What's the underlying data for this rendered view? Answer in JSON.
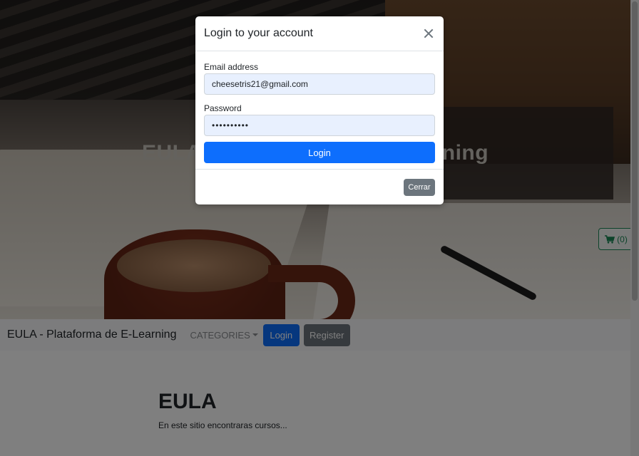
{
  "hero": {
    "title": "EULA - Plataforma de E-Learning"
  },
  "cart": {
    "label": "(0)",
    "icon": "shopping-cart-icon",
    "color": "#198754"
  },
  "navbar": {
    "brand": "EULA - Plataforma de E-Learning",
    "categories": "CATEGORIES",
    "login": "Login",
    "register": "Register"
  },
  "main": {
    "heading": "EULA",
    "description": "En este sitio encontraras cursos..."
  },
  "modal": {
    "title": "Login to your account",
    "email_label": "Email address",
    "email_value": "cheesetris21@gmail.com",
    "password_label": "Password",
    "password_value": "••••••••••",
    "login_button": "Login",
    "close_button": "Cerrar"
  },
  "colors": {
    "primary": "#0d6efd",
    "secondary": "#6c757d"
  }
}
